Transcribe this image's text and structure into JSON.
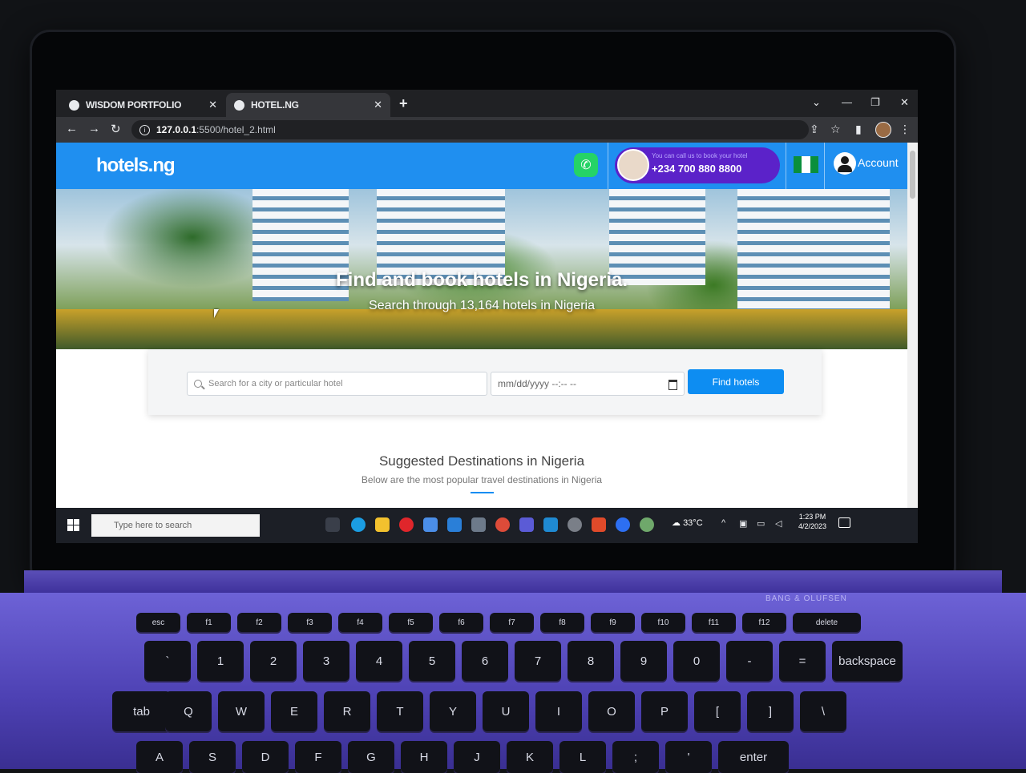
{
  "browser": {
    "tabs": [
      {
        "title": "WISDOM PORTFOLIO",
        "active": false
      },
      {
        "title": "HOTEL.NG",
        "active": true
      }
    ],
    "url_host": "127.0.0.1",
    "url_path": ":5500/hotel_2.html"
  },
  "site": {
    "logo": "hotels.ng",
    "call_text": "You can call us to book your hotel",
    "phone": "+234 700 880 8800",
    "account_label": "Account",
    "hero_title": "Find and book hotels in Nigeria.",
    "hero_subtitle": "Search through 13,164 hotels in Nigeria",
    "search_placeholder": "Search for a city or particular hotel",
    "date_placeholder": "mm/dd/yyyy --:-- --",
    "find_button": "Find hotels",
    "section_title": "Suggested Destinations in Nigeria",
    "section_subtitle": "Below are the most popular travel destinations in Nigeria"
  },
  "taskbar": {
    "search_placeholder": "Type here to search",
    "weather": "33°C",
    "time": "1:23 PM",
    "date": "4/2/2023"
  },
  "colors": {
    "header_blue": "#1f8ff0",
    "button_blue": "#0d8df2",
    "call_pill_purple": "#5b22c9",
    "whatsapp_green": "#25d366",
    "nigeria_green": "#0a8f3c"
  },
  "keyboard": {
    "brand": "BANG & OLUFSEN",
    "row1": [
      "esc",
      "f1",
      "f2",
      "f3",
      "f4",
      "f5",
      "f6",
      "f7",
      "f8",
      "f9",
      "f10",
      "f11",
      "f12",
      "delete"
    ],
    "row2": [
      "`",
      "1",
      "2",
      "3",
      "4",
      "5",
      "6",
      "7",
      "8",
      "9",
      "0",
      "-",
      "=",
      "backspace"
    ],
    "row3": [
      "tab",
      "Q",
      "W",
      "E",
      "R",
      "T",
      "Y",
      "U",
      "I",
      "O",
      "P",
      "[",
      "]",
      "\\"
    ],
    "row4": [
      "A",
      "S",
      "D",
      "F",
      "G",
      "H",
      "J",
      "K",
      "L",
      ";",
      "'",
      "enter"
    ]
  }
}
